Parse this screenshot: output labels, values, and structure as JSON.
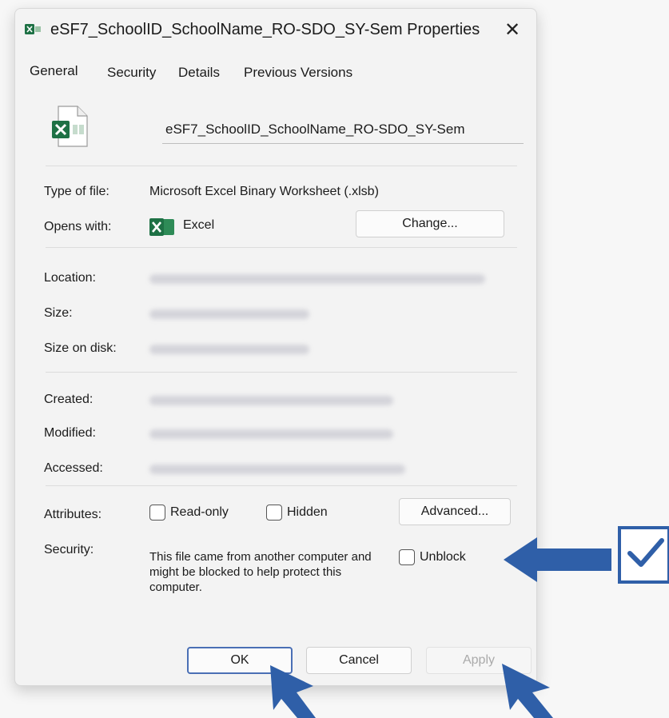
{
  "window": {
    "title": "eSF7_SchoolID_SchoolName_RO-SDO_SY-Sem Properties",
    "close_glyph": "✕"
  },
  "tabs": [
    {
      "label": "General",
      "active": true
    },
    {
      "label": "Security"
    },
    {
      "label": "Details"
    },
    {
      "label": "Previous Versions"
    }
  ],
  "file": {
    "icon": "excel-file-icon",
    "name": "eSF7_SchoolID_SchoolName_RO-SDO_SY-Sem"
  },
  "type_row": {
    "label": "Type of file:",
    "value": "Microsoft Excel Binary Worksheet (.xlsb)"
  },
  "opens_row": {
    "label": "Opens with:",
    "app_name": "Excel",
    "change_button": "Change..."
  },
  "location_row": {
    "label": "Location:"
  },
  "size_row": {
    "label": "Size:"
  },
  "size_on_disk_row": {
    "label": "Size on disk:"
  },
  "created_row": {
    "label": "Created:"
  },
  "modified_row": {
    "label": "Modified:"
  },
  "accessed_row": {
    "label": "Accessed:"
  },
  "attributes": {
    "label": "Attributes:",
    "read_only": "Read-only",
    "hidden": "Hidden",
    "advanced_button": "Advanced..."
  },
  "security": {
    "label": "Security:",
    "message": "This file came from another computer and might be blocked to help protect this computer.",
    "unblock_label": "Unblock"
  },
  "footer": {
    "ok": "OK",
    "cancel": "Cancel",
    "apply": "Apply"
  },
  "colors": {
    "accent": "#2f5fa8",
    "excel_green": "#1e7145",
    "dialog_bg": "#f3f3f3"
  }
}
